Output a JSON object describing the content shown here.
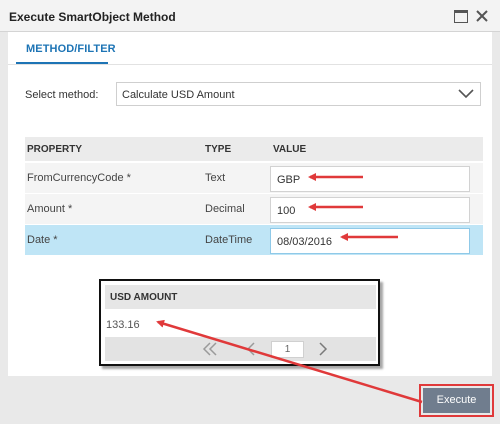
{
  "window": {
    "title": "Execute SmartObject Method"
  },
  "tabs": [
    {
      "label": "METHOD/FILTER",
      "active": true
    }
  ],
  "method": {
    "label": "Select method:",
    "selected": "Calculate USD Amount"
  },
  "table": {
    "headers": [
      "PROPERTY",
      "TYPE",
      "VALUE"
    ],
    "rows": [
      {
        "property": "FromCurrencyCode *",
        "type": "Text",
        "value": "GBP",
        "selected": false
      },
      {
        "property": "Amount *",
        "type": "Decimal",
        "value": "100",
        "selected": false
      },
      {
        "property": "Date *",
        "type": "DateTime",
        "value": "08/03/2016",
        "selected": true
      }
    ]
  },
  "result": {
    "header": "USD AMOUNT",
    "value": "133.16",
    "pager": {
      "first_icon": "double-chevron-left-icon",
      "prev_icon": "chevron-left-icon",
      "page": "1",
      "next_icon": "chevron-right-icon"
    }
  },
  "actions": {
    "execute_label": "Execute"
  },
  "colors": {
    "accent": "#1d74b5",
    "selected_row": "#bfe5f6",
    "annotation_red": "#e0393a",
    "execute_button": "#707d8e"
  }
}
